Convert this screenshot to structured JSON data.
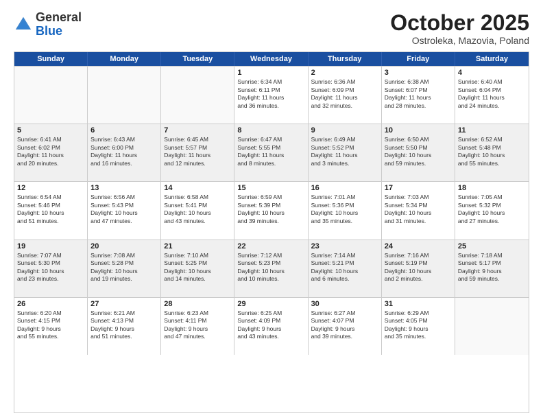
{
  "header": {
    "logo": {
      "general": "General",
      "blue": "Blue"
    },
    "title": "October 2025",
    "subtitle": "Ostroleka, Mazovia, Poland"
  },
  "days_of_week": [
    "Sunday",
    "Monday",
    "Tuesday",
    "Wednesday",
    "Thursday",
    "Friday",
    "Saturday"
  ],
  "weeks": [
    [
      {
        "day": "",
        "empty": true
      },
      {
        "day": "",
        "empty": true
      },
      {
        "day": "",
        "empty": true
      },
      {
        "day": "1",
        "lines": [
          "Sunrise: 6:34 AM",
          "Sunset: 6:11 PM",
          "Daylight: 11 hours",
          "and 36 minutes."
        ]
      },
      {
        "day": "2",
        "lines": [
          "Sunrise: 6:36 AM",
          "Sunset: 6:09 PM",
          "Daylight: 11 hours",
          "and 32 minutes."
        ]
      },
      {
        "day": "3",
        "lines": [
          "Sunrise: 6:38 AM",
          "Sunset: 6:07 PM",
          "Daylight: 11 hours",
          "and 28 minutes."
        ]
      },
      {
        "day": "4",
        "lines": [
          "Sunrise: 6:40 AM",
          "Sunset: 6:04 PM",
          "Daylight: 11 hours",
          "and 24 minutes."
        ]
      }
    ],
    [
      {
        "day": "5",
        "lines": [
          "Sunrise: 6:41 AM",
          "Sunset: 6:02 PM",
          "Daylight: 11 hours",
          "and 20 minutes."
        ]
      },
      {
        "day": "6",
        "lines": [
          "Sunrise: 6:43 AM",
          "Sunset: 6:00 PM",
          "Daylight: 11 hours",
          "and 16 minutes."
        ]
      },
      {
        "day": "7",
        "lines": [
          "Sunrise: 6:45 AM",
          "Sunset: 5:57 PM",
          "Daylight: 11 hours",
          "and 12 minutes."
        ]
      },
      {
        "day": "8",
        "lines": [
          "Sunrise: 6:47 AM",
          "Sunset: 5:55 PM",
          "Daylight: 11 hours",
          "and 8 minutes."
        ]
      },
      {
        "day": "9",
        "lines": [
          "Sunrise: 6:49 AM",
          "Sunset: 5:52 PM",
          "Daylight: 11 hours",
          "and 3 minutes."
        ]
      },
      {
        "day": "10",
        "lines": [
          "Sunrise: 6:50 AM",
          "Sunset: 5:50 PM",
          "Daylight: 10 hours",
          "and 59 minutes."
        ]
      },
      {
        "day": "11",
        "lines": [
          "Sunrise: 6:52 AM",
          "Sunset: 5:48 PM",
          "Daylight: 10 hours",
          "and 55 minutes."
        ]
      }
    ],
    [
      {
        "day": "12",
        "lines": [
          "Sunrise: 6:54 AM",
          "Sunset: 5:46 PM",
          "Daylight: 10 hours",
          "and 51 minutes."
        ]
      },
      {
        "day": "13",
        "lines": [
          "Sunrise: 6:56 AM",
          "Sunset: 5:43 PM",
          "Daylight: 10 hours",
          "and 47 minutes."
        ]
      },
      {
        "day": "14",
        "lines": [
          "Sunrise: 6:58 AM",
          "Sunset: 5:41 PM",
          "Daylight: 10 hours",
          "and 43 minutes."
        ]
      },
      {
        "day": "15",
        "lines": [
          "Sunrise: 6:59 AM",
          "Sunset: 5:39 PM",
          "Daylight: 10 hours",
          "and 39 minutes."
        ]
      },
      {
        "day": "16",
        "lines": [
          "Sunrise: 7:01 AM",
          "Sunset: 5:36 PM",
          "Daylight: 10 hours",
          "and 35 minutes."
        ]
      },
      {
        "day": "17",
        "lines": [
          "Sunrise: 7:03 AM",
          "Sunset: 5:34 PM",
          "Daylight: 10 hours",
          "and 31 minutes."
        ]
      },
      {
        "day": "18",
        "lines": [
          "Sunrise: 7:05 AM",
          "Sunset: 5:32 PM",
          "Daylight: 10 hours",
          "and 27 minutes."
        ]
      }
    ],
    [
      {
        "day": "19",
        "lines": [
          "Sunrise: 7:07 AM",
          "Sunset: 5:30 PM",
          "Daylight: 10 hours",
          "and 23 minutes."
        ]
      },
      {
        "day": "20",
        "lines": [
          "Sunrise: 7:08 AM",
          "Sunset: 5:28 PM",
          "Daylight: 10 hours",
          "and 19 minutes."
        ]
      },
      {
        "day": "21",
        "lines": [
          "Sunrise: 7:10 AM",
          "Sunset: 5:25 PM",
          "Daylight: 10 hours",
          "and 14 minutes."
        ]
      },
      {
        "day": "22",
        "lines": [
          "Sunrise: 7:12 AM",
          "Sunset: 5:23 PM",
          "Daylight: 10 hours",
          "and 10 minutes."
        ]
      },
      {
        "day": "23",
        "lines": [
          "Sunrise: 7:14 AM",
          "Sunset: 5:21 PM",
          "Daylight: 10 hours",
          "and 6 minutes."
        ]
      },
      {
        "day": "24",
        "lines": [
          "Sunrise: 7:16 AM",
          "Sunset: 5:19 PM",
          "Daylight: 10 hours",
          "and 2 minutes."
        ]
      },
      {
        "day": "25",
        "lines": [
          "Sunrise: 7:18 AM",
          "Sunset: 5:17 PM",
          "Daylight: 9 hours",
          "and 59 minutes."
        ]
      }
    ],
    [
      {
        "day": "26",
        "lines": [
          "Sunrise: 6:20 AM",
          "Sunset: 4:15 PM",
          "Daylight: 9 hours",
          "and 55 minutes."
        ]
      },
      {
        "day": "27",
        "lines": [
          "Sunrise: 6:21 AM",
          "Sunset: 4:13 PM",
          "Daylight: 9 hours",
          "and 51 minutes."
        ]
      },
      {
        "day": "28",
        "lines": [
          "Sunrise: 6:23 AM",
          "Sunset: 4:11 PM",
          "Daylight: 9 hours",
          "and 47 minutes."
        ]
      },
      {
        "day": "29",
        "lines": [
          "Sunrise: 6:25 AM",
          "Sunset: 4:09 PM",
          "Daylight: 9 hours",
          "and 43 minutes."
        ]
      },
      {
        "day": "30",
        "lines": [
          "Sunrise: 6:27 AM",
          "Sunset: 4:07 PM",
          "Daylight: 9 hours",
          "and 39 minutes."
        ]
      },
      {
        "day": "31",
        "lines": [
          "Sunrise: 6:29 AM",
          "Sunset: 4:05 PM",
          "Daylight: 9 hours",
          "and 35 minutes."
        ]
      },
      {
        "day": "",
        "empty": true
      }
    ]
  ]
}
